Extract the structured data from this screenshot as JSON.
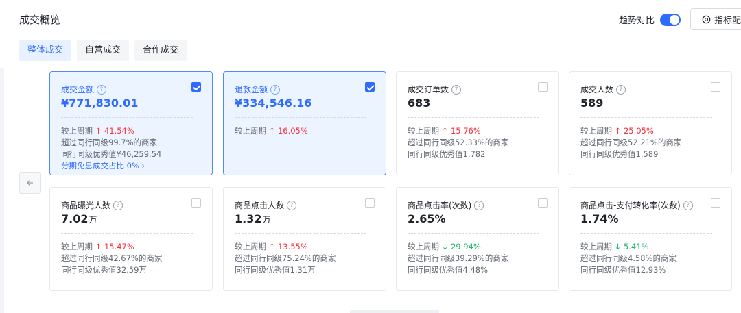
{
  "header": {
    "title": "成交概览",
    "trend_label": "趋势对比",
    "trend_on": true,
    "config_label": "指标配置"
  },
  "tabs": [
    {
      "label": "整体成交",
      "active": true
    },
    {
      "label": "自营成交",
      "active": false
    },
    {
      "label": "合作成交",
      "active": false
    }
  ],
  "cards": [
    {
      "label": "成交金额",
      "value": "¥771,830.01",
      "unit": "",
      "checked": true,
      "compare_prefix": "较上周期",
      "compare_dir": "up",
      "compare_value": "41.54%",
      "industry": "超过同行同级99.7%的商家",
      "excellent": "同行同级优秀值¥46,259.54",
      "extra_link": "分期免息成交占比 0% ›"
    },
    {
      "label": "退款金额",
      "value": "¥334,546.16",
      "unit": "",
      "checked": true,
      "compare_prefix": "较上周期",
      "compare_dir": "up",
      "compare_value": "16.05%",
      "industry": "",
      "excellent": "",
      "extra_link": ""
    },
    {
      "label": "成交订单数",
      "value": "683",
      "unit": "",
      "checked": false,
      "compare_prefix": "较上周期",
      "compare_dir": "up",
      "compare_value": "15.76%",
      "industry": "超过同行同级52.33%的商家",
      "excellent": "同行同级优秀值1,782",
      "extra_link": ""
    },
    {
      "label": "成交人数",
      "value": "589",
      "unit": "",
      "checked": false,
      "compare_prefix": "较上周期",
      "compare_dir": "up",
      "compare_value": "25.05%",
      "industry": "超过同行同级52.21%的商家",
      "excellent": "同行同级优秀值1,589",
      "extra_link": ""
    },
    {
      "label": "商品曝光人数",
      "value": "7.02",
      "unit": "万",
      "checked": false,
      "compare_prefix": "较上周期",
      "compare_dir": "up",
      "compare_value": "15.47%",
      "industry": "超过同行同级42.67%的商家",
      "excellent": "同行同级优秀值32.59万",
      "extra_link": ""
    },
    {
      "label": "商品点击人数",
      "value": "1.32",
      "unit": "万",
      "checked": false,
      "compare_prefix": "较上周期",
      "compare_dir": "up",
      "compare_value": "13.55%",
      "industry": "超过同行同级75.24%的商家",
      "excellent": "同行同级优秀值1.31万",
      "extra_link": ""
    },
    {
      "label": "商品点击率(次数)",
      "value": "2.65%",
      "unit": "",
      "checked": false,
      "compare_prefix": "较上周期",
      "compare_dir": "down",
      "compare_value": "29.94%",
      "industry": "超过同行同级39.29%的商家",
      "excellent": "同行同级优秀值4.48%",
      "extra_link": ""
    },
    {
      "label": "商品点击-支付转化率(次数)",
      "value": "1.74%",
      "unit": "",
      "checked": false,
      "compare_prefix": "较上周期",
      "compare_dir": "down",
      "compare_value": "5.41%",
      "industry": "超过同行同级4.58%的商家",
      "excellent": "同行同级优秀值12.93%",
      "extra_link": ""
    }
  ],
  "icons": {
    "help": "question-circle-icon",
    "prev": "arrow-left-icon",
    "config": "settings-icon"
  },
  "colors": {
    "accent": "#2f6bff",
    "up": "#f5313d",
    "down": "#1fb46a"
  }
}
